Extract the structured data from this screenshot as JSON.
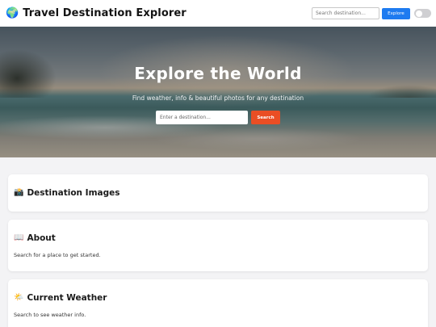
{
  "header": {
    "title": "Travel Destination Explorer",
    "logo_icon": "🌍",
    "search_placeholder": "Search destination...",
    "explore_label": "Explore",
    "theme_toggle_state": "off"
  },
  "hero": {
    "title": "Explore the World",
    "subtitle": "Find weather, info & beautiful photos for any destination",
    "input_placeholder": "Enter a destination...",
    "search_label": "Search"
  },
  "sections": {
    "images": {
      "icon": "📸",
      "title": "Destination Images"
    },
    "about": {
      "icon": "📖",
      "title": "About",
      "text": "Search for a place to get started."
    },
    "weather": {
      "icon": "🌤️",
      "title": "Current Weather",
      "text": "Search to see weather info."
    }
  },
  "colors": {
    "primary_button": "#1e7bf0",
    "hero_button": "#ea4e24",
    "page_background": "#f3f3f5"
  }
}
